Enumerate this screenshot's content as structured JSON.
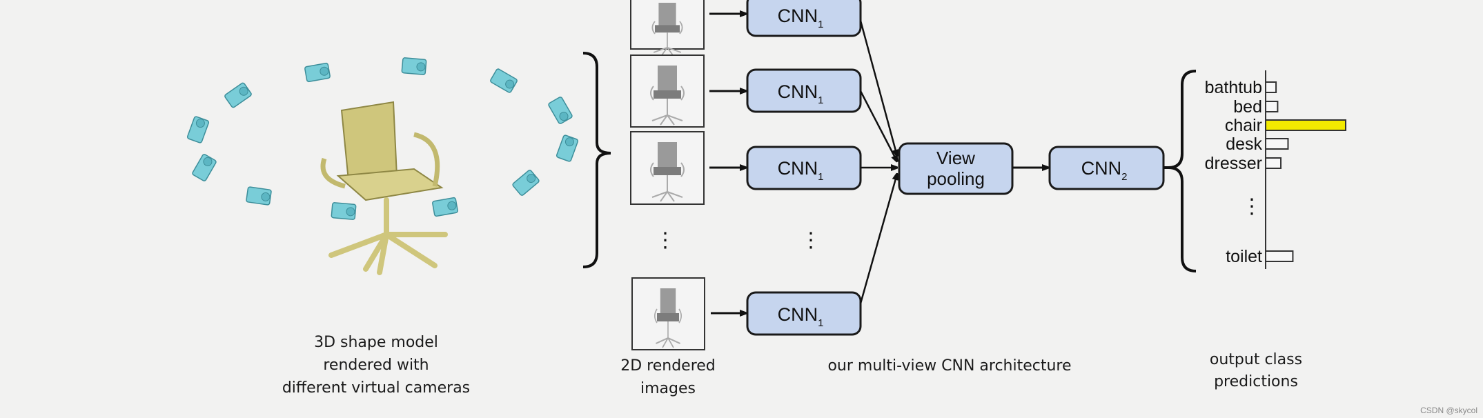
{
  "captions": {
    "shape_model": [
      "3D shape model",
      "rendered with",
      "different virtual cameras"
    ],
    "rendered_images": [
      "2D rendered",
      "images"
    ],
    "architecture": "our multi-view CNN architecture",
    "predictions": [
      "output class",
      "predictions"
    ]
  },
  "blocks": {
    "cnn1": {
      "name": "CNN",
      "sub": "1"
    },
    "cnn2": {
      "name": "CNN",
      "sub": "2"
    },
    "view_pooling": [
      "View",
      "pooling"
    ]
  },
  "ellipsis": "⋮",
  "chart_data": {
    "type": "bar",
    "orientation": "horizontal",
    "categories": [
      "bathtub",
      "bed",
      "chair",
      "desk",
      "dresser",
      "⋮",
      "toilet"
    ],
    "values": [
      0.13,
      0.15,
      1.0,
      0.28,
      0.19,
      null,
      0.34
    ],
    "highlight": "chair",
    "colors": {
      "highlight": "#f2ea00",
      "default": "#f7f7f7"
    }
  },
  "colors": {
    "block_fill": "#c6d5ee",
    "camera": "#79cdd8",
    "chair": "#d4cc88"
  },
  "watermark": "CSDN @skycol"
}
